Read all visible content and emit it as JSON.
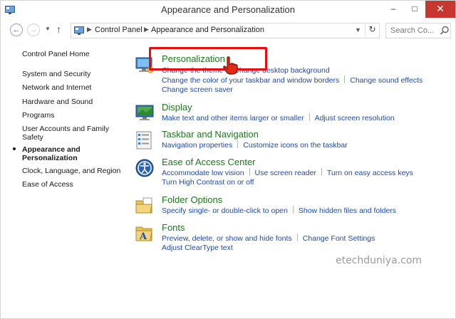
{
  "window": {
    "title": "Appearance and Personalization",
    "minimize": "–",
    "maximize": "□",
    "close": "✕"
  },
  "nav": {
    "back": "←",
    "forward": "→",
    "history_dropdown": "▼",
    "up": "↑",
    "breadcrumbs": [
      "Control Panel",
      "Appearance and Personalization"
    ],
    "breadcrumb_sep": "▶",
    "address_dropdown": "▼",
    "refresh": "↻",
    "search_placeholder": "Search Co..."
  },
  "sidebar": {
    "home": "Control Panel Home",
    "items": [
      "System and Security",
      "Network and Internet",
      "Hardware and Sound",
      "Programs",
      "User Accounts and Family Safety",
      "Appearance and Personalization",
      "Clock, Language, and Region",
      "Ease of Access"
    ],
    "current_index": 5
  },
  "categories": [
    {
      "title": "Personalization",
      "icon": "personalization-icon",
      "link_rows": [
        [
          "Change the theme",
          "Change desktop background"
        ],
        [
          "Change the color of your taskbar and window borders",
          "Change sound effects"
        ],
        [
          "Change screen saver"
        ]
      ]
    },
    {
      "title": "Display",
      "icon": "display-icon",
      "link_rows": [
        [
          "Make text and other items larger or smaller",
          "Adjust screen resolution"
        ]
      ]
    },
    {
      "title": "Taskbar and Navigation",
      "icon": "taskbar-icon",
      "link_rows": [
        [
          "Navigation properties",
          "Customize icons on the taskbar"
        ]
      ]
    },
    {
      "title": "Ease of Access Center",
      "icon": "ease-of-access-icon",
      "link_rows": [
        [
          "Accommodate low vision",
          "Use screen reader",
          "Turn on easy access keys"
        ],
        [
          "Turn High Contrast on or off"
        ]
      ]
    },
    {
      "title": "Folder Options",
      "icon": "folder-options-icon",
      "link_rows": [
        [
          "Specify single- or double-click to open",
          "Show hidden files and folders"
        ]
      ]
    },
    {
      "title": "Fonts",
      "icon": "fonts-icon",
      "link_rows": [
        [
          "Preview, delete, or show and hide fonts",
          "Change Font Settings"
        ],
        [
          "Adjust ClearType text"
        ]
      ]
    }
  ],
  "watermark": "etechduniya.com",
  "colors": {
    "category_title": "#1a7a1a",
    "link": "#1f4aa8",
    "highlight": "#e60f0f",
    "close_button": "#c7372f"
  }
}
